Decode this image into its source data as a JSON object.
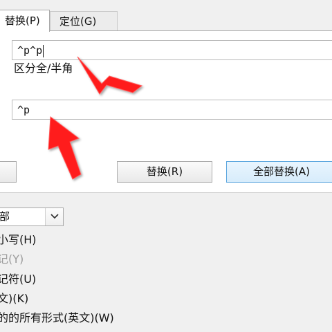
{
  "tabs": [
    {
      "label": "替换(P)"
    },
    {
      "label": "定位(G)"
    }
  ],
  "find": {
    "value": "^p^p"
  },
  "caption": "区分全/半角",
  "replace": {
    "value": "^p"
  },
  "buttons": {
    "partial_label": "",
    "replace_label": "替换(R)",
    "replace_all_label": "全部替换(A)"
  },
  "scope_select": {
    "visible_text": "部"
  },
  "options": [
    {
      "label": "小写(H)",
      "enabled": true
    },
    {
      "label": "记(Y)",
      "enabled": false
    },
    {
      "label": "记符(U)",
      "enabled": true
    },
    {
      "label": "文)(K)",
      "enabled": true
    },
    {
      "label": "的的所有形式(英文)(W)",
      "enabled": true
    }
  ],
  "icons": {
    "dropdown": "chevron-down-icon",
    "annotation_arrows": [
      "arrow-pointer-icon",
      "arrow-pointer-icon"
    ]
  },
  "colors": {
    "accent": "#5ea7df",
    "arrow": "#ff1c1c",
    "panel_bg": "#ffffff",
    "window_bg": "#f0f0f0"
  }
}
